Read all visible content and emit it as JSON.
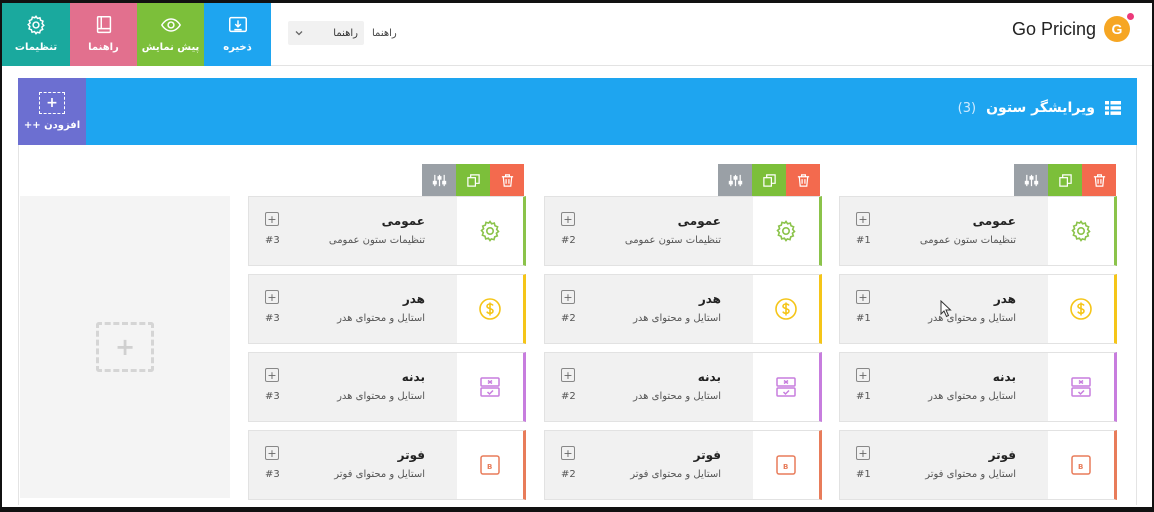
{
  "brand": {
    "name": "Go Pricing",
    "logo_letter": "G",
    "logo_color": "#f6a623"
  },
  "toolbar": {
    "settings_label": "تنظیمات",
    "guide_label": "راهنما",
    "preview_label": "پیش نمایش",
    "save_label": "ذخیره",
    "colors": {
      "settings": "#1aa99e",
      "guide": "#e2708e",
      "preview": "#7cbf3a",
      "save": "#1ea5f0"
    }
  },
  "help_select": {
    "label": "راهنما",
    "value": "راهنما"
  },
  "editor": {
    "title": "ویرایشگر ستون",
    "count": "(3)",
    "add_label": "++ افزودن",
    "bar_color": "#1ea5f0",
    "add_color": "#6c6fd1"
  },
  "columns": [
    {
      "number": "#1",
      "cards": [
        {
          "title": "عمومی",
          "subtitle": "تنظیمات ستون عمومی",
          "icon": "gear-icon"
        },
        {
          "title": "هدر",
          "subtitle": "استایل و محتوای هدر",
          "icon": "dollar-icon"
        },
        {
          "title": "بدنه",
          "subtitle": "استایل و محتوای هدر",
          "icon": "checklist-icon"
        },
        {
          "title": "فوتر",
          "subtitle": "استایل و محتوای فوتر",
          "icon": "button-icon"
        }
      ]
    },
    {
      "number": "#2",
      "cards": [
        {
          "title": "عمومی",
          "subtitle": "تنظیمات ستون عمومی",
          "icon": "gear-icon"
        },
        {
          "title": "هدر",
          "subtitle": "استایل و محتوای هدر",
          "icon": "dollar-icon"
        },
        {
          "title": "بدنه",
          "subtitle": "استایل و محتوای هدر",
          "icon": "checklist-icon"
        },
        {
          "title": "فوتر",
          "subtitle": "استایل و محتوای فوتر",
          "icon": "button-icon"
        }
      ]
    },
    {
      "number": "#3",
      "cards": [
        {
          "title": "عمومی",
          "subtitle": "تنظیمات ستون عمومی",
          "icon": "gear-icon"
        },
        {
          "title": "هدر",
          "subtitle": "استایل و محتوای هدر",
          "icon": "dollar-icon"
        },
        {
          "title": "بدنه",
          "subtitle": "استایل و محتوای هدر",
          "icon": "checklist-icon"
        },
        {
          "title": "فوتر",
          "subtitle": "استایل و محتوای فوتر",
          "icon": "button-icon"
        }
      ]
    }
  ]
}
